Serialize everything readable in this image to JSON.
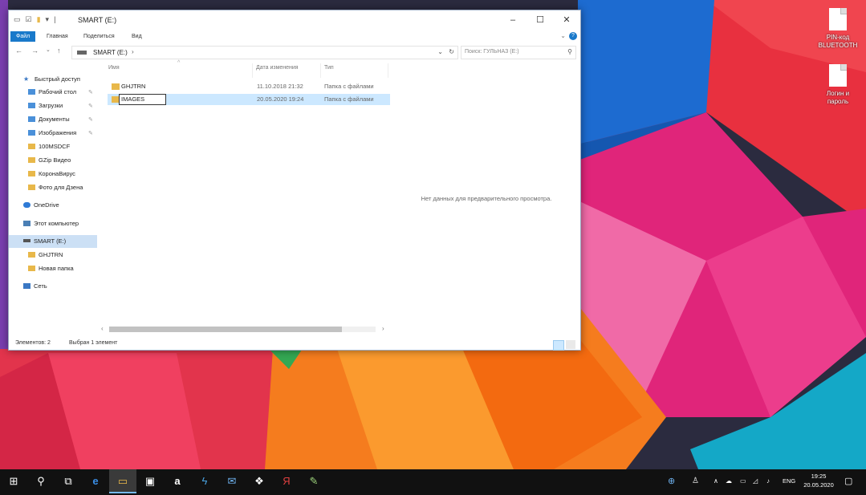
{
  "desktop": {
    "icons": [
      {
        "label_line1": "PIN-код",
        "label_line2": "BLUETOOTH"
      },
      {
        "label_line1": "Логин и",
        "label_line2": "пароль"
      }
    ]
  },
  "window": {
    "title": "SMART (E:)",
    "controls": {
      "minimize": "–",
      "maximize": "☐",
      "close": "✕"
    },
    "ribbon_tabs": [
      "Файл",
      "Главная",
      "Поделиться",
      "Вид"
    ],
    "address": {
      "path": "SMART (E:)",
      "separator": "›"
    },
    "search": {
      "placeholder": "Поиск: ГУЛЬНАЗ (E:)"
    },
    "nav": {
      "quick_access": "Быстрый доступ",
      "items": [
        "Рабочий стол",
        "Загрузки",
        "Документы",
        "Изображения",
        "100MSDCF",
        "GZip Видео",
        "КоронаВирус",
        "Фото для Дзена"
      ],
      "onedrive": "OneDrive",
      "this_pc": "Этот компьютер",
      "drive": "SMART (E:)",
      "drive_children": [
        "GHJTRN",
        "Новая папка"
      ],
      "network": "Сеть"
    },
    "columns": {
      "name": "Имя",
      "date": "Дата изменения",
      "type": "Тип"
    },
    "files": [
      {
        "name": "GHJTRN",
        "date": "11.10.2018 21:32",
        "type": "Папка с файлами"
      },
      {
        "name": "IMAGES",
        "date": "20.05.2020 19:24",
        "type": "Папка с файлами"
      }
    ],
    "preview_text": "Нет данных для предварительного просмотра.",
    "status": {
      "items": "Элементов: 2",
      "selected": "Выбран 1 элемент"
    }
  },
  "taskbar": {
    "tray_lang": "ENG",
    "time": "19:25",
    "date": "20.05.2020"
  }
}
